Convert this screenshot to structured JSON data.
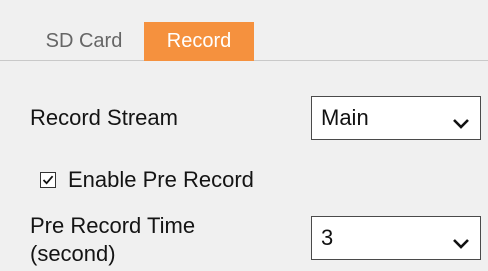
{
  "tabs": [
    {
      "label": "SD Card",
      "active": false
    },
    {
      "label": "Record",
      "active": true
    }
  ],
  "accent_color": "#f5913e",
  "record_stream": {
    "label": "Record Stream",
    "selected": "Main"
  },
  "pre_record": {
    "label": "Enable Pre Record",
    "checked": true
  },
  "pre_record_time": {
    "label_line1": "Pre Record Time",
    "label_line2": "(second)",
    "selected": "3"
  },
  "icons": {
    "dropdown": "chevron-down-icon",
    "checkbox": "checkmark-icon"
  }
}
